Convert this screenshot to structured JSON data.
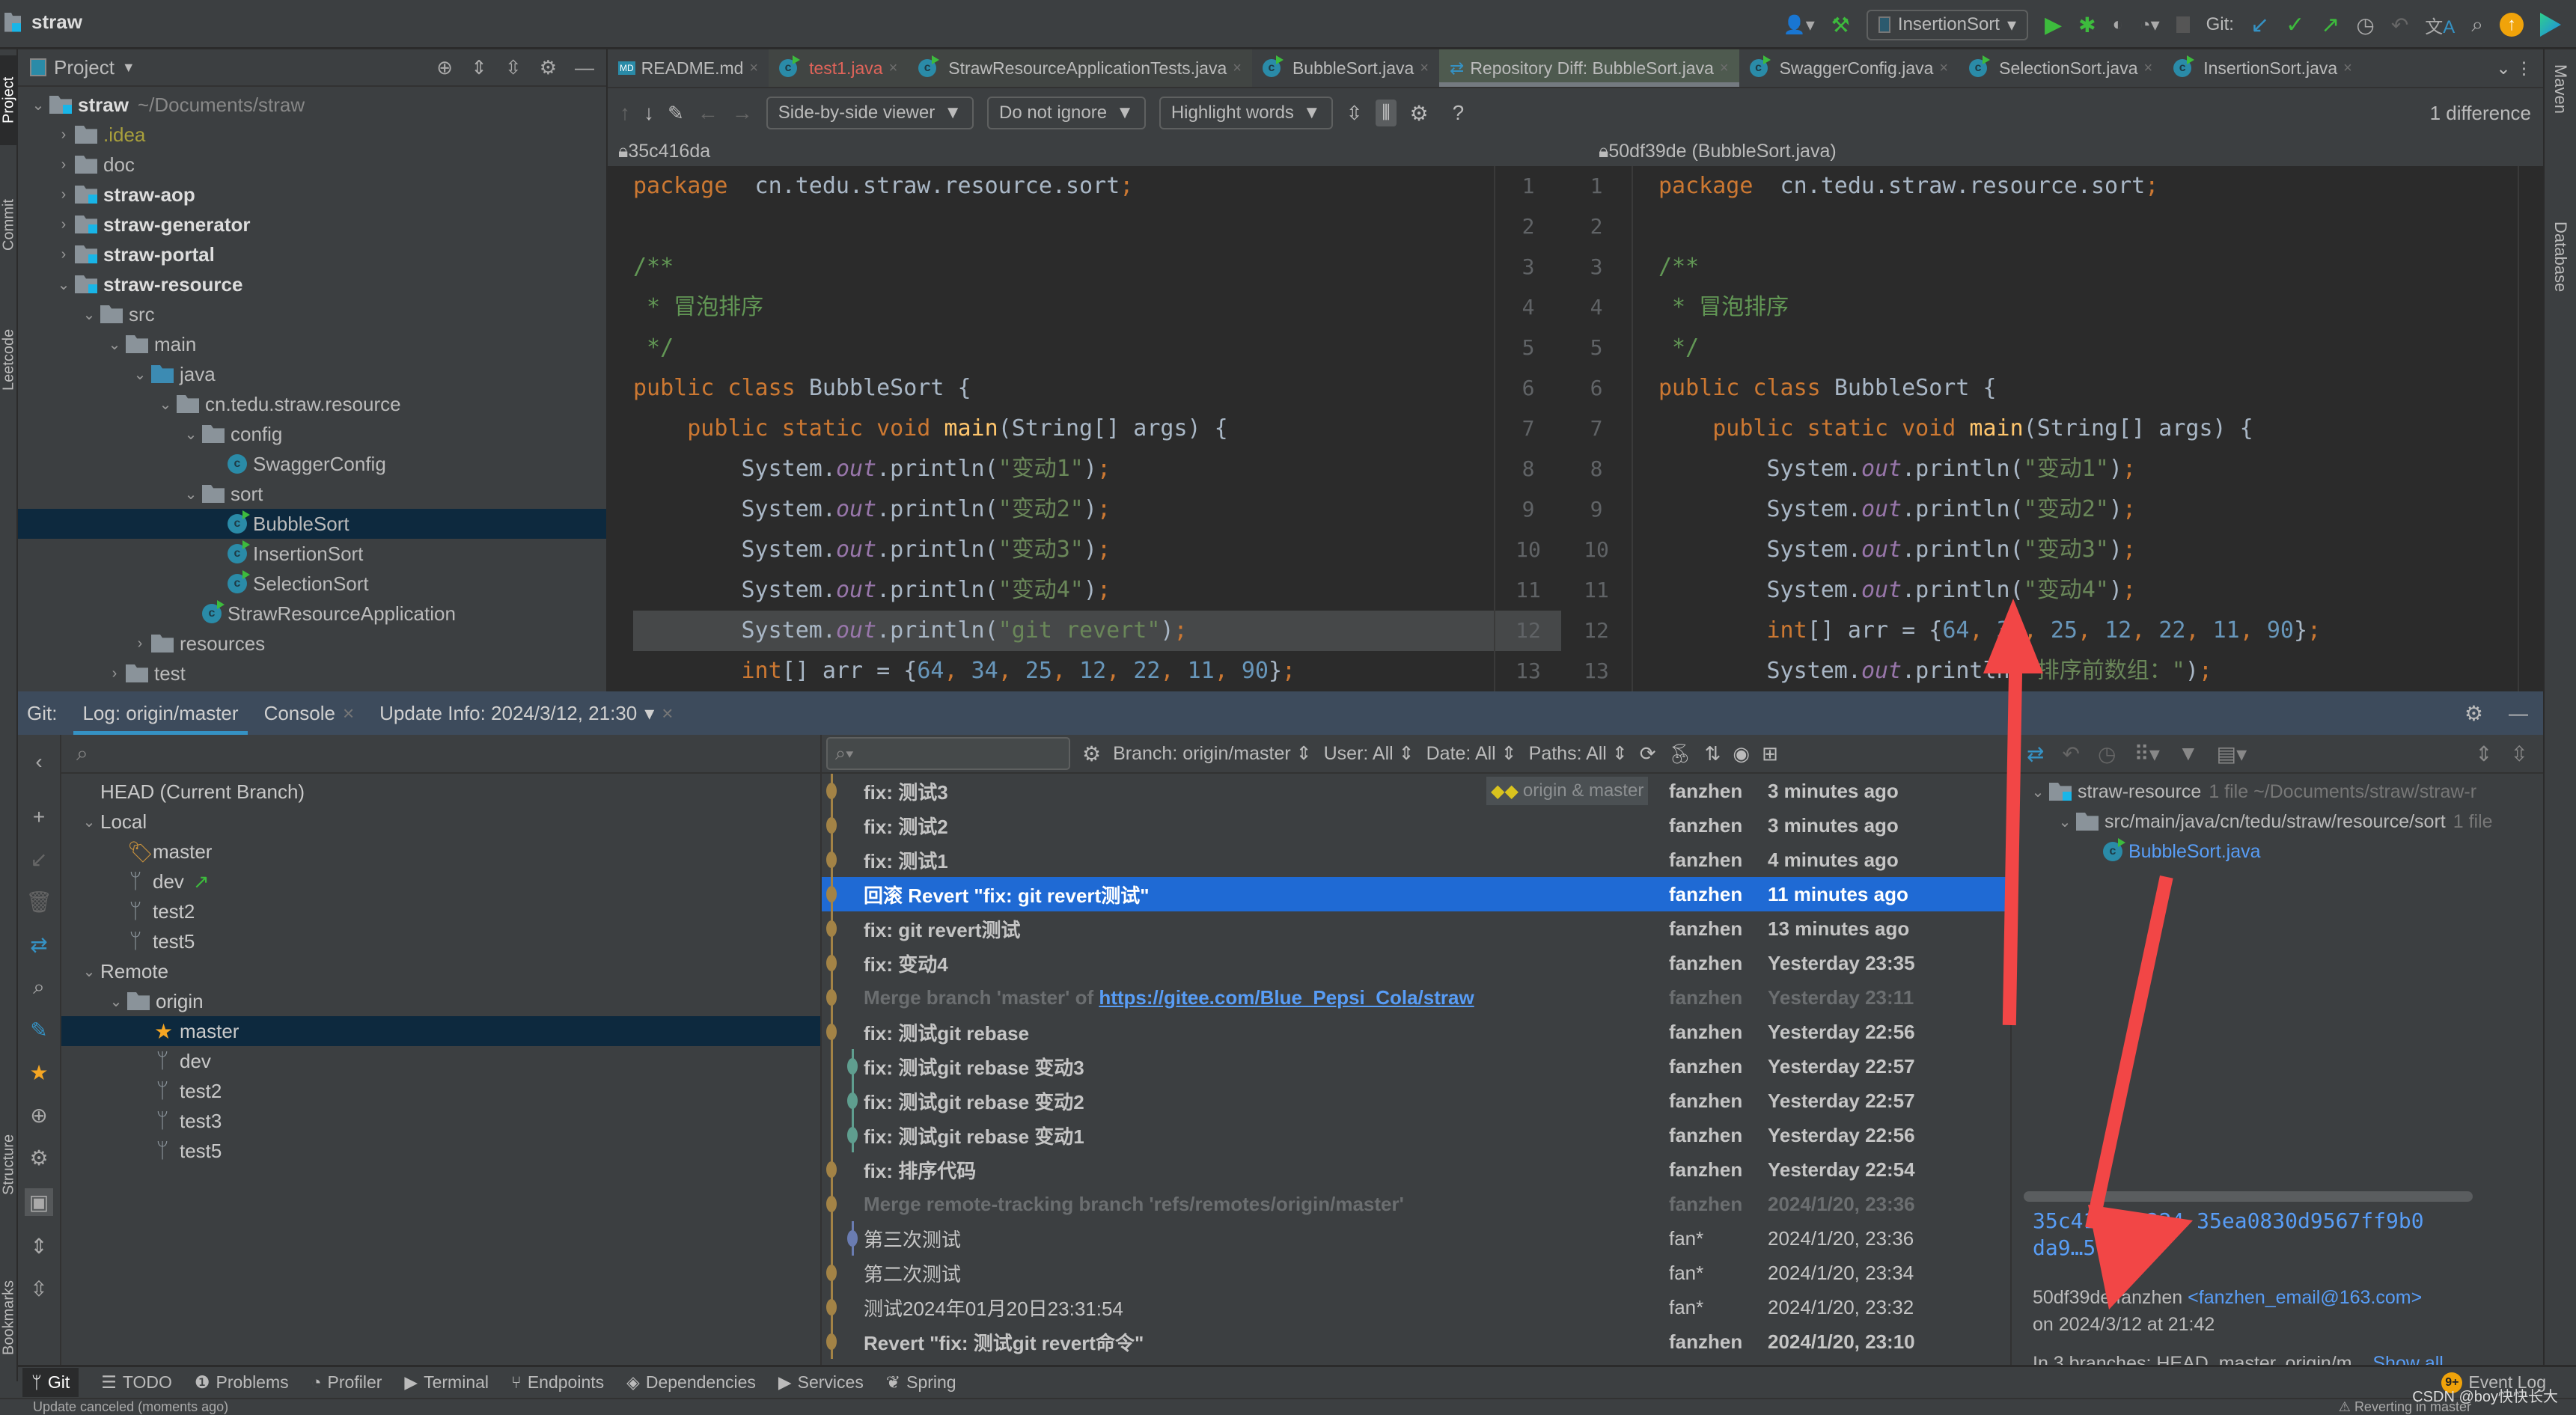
{
  "window": {
    "project_name": "straw"
  },
  "toolbar_top": {
    "run_config": "InsertionSort",
    "git_label": "Git:",
    "icons": [
      "user-icon",
      "build-hammer-icon",
      "run-icon",
      "debug-icon",
      "coverage-icon",
      "profile-icon",
      "stop-icon",
      "git-update-icon",
      "git-commit-icon",
      "git-push-icon",
      "history-icon",
      "rollback-icon",
      "translate-icon",
      "search-icon",
      "update-icon",
      "toolbox-icon"
    ]
  },
  "side_tabs_left": [
    "Project",
    "Commit",
    "Leetcode",
    "Structure",
    "Bookmarks"
  ],
  "side_tabs_right": [
    "Maven",
    "Database"
  ],
  "project_panel": {
    "title": "Project",
    "tree": [
      {
        "label": "straw",
        "hint": "~/Documents/straw",
        "depth": 0,
        "expanded": true,
        "type": "module",
        "bold": true
      },
      {
        "label": ".idea",
        "depth": 1,
        "expanded": false,
        "type": "folder",
        "color": "#a9a03c"
      },
      {
        "label": "doc",
        "depth": 1,
        "expanded": false,
        "type": "folder"
      },
      {
        "label": "straw-aop",
        "depth": 1,
        "expanded": false,
        "type": "module",
        "bold": true
      },
      {
        "label": "straw-generator",
        "depth": 1,
        "expanded": false,
        "type": "module",
        "bold": true
      },
      {
        "label": "straw-portal",
        "depth": 1,
        "expanded": false,
        "type": "module",
        "bold": true
      },
      {
        "label": "straw-resource",
        "depth": 1,
        "expanded": true,
        "type": "module",
        "bold": true
      },
      {
        "label": "src",
        "depth": 2,
        "expanded": true,
        "type": "folder"
      },
      {
        "label": "main",
        "depth": 3,
        "expanded": true,
        "type": "folder"
      },
      {
        "label": "java",
        "depth": 4,
        "expanded": true,
        "type": "src"
      },
      {
        "label": "cn.tedu.straw.resource",
        "depth": 5,
        "expanded": true,
        "type": "package"
      },
      {
        "label": "config",
        "depth": 6,
        "expanded": true,
        "type": "package"
      },
      {
        "label": "SwaggerConfig",
        "depth": 7,
        "type": "class"
      },
      {
        "label": "sort",
        "depth": 6,
        "expanded": true,
        "type": "package"
      },
      {
        "label": "BubbleSort",
        "depth": 7,
        "type": "class-run",
        "selected": true
      },
      {
        "label": "InsertionSort",
        "depth": 7,
        "type": "class-run"
      },
      {
        "label": "SelectionSort",
        "depth": 7,
        "type": "class-run"
      },
      {
        "label": "StrawResourceApplication",
        "depth": 6,
        "type": "class-run"
      },
      {
        "label": "resources",
        "depth": 4,
        "expanded": false,
        "type": "folder"
      },
      {
        "label": "test",
        "depth": 3,
        "expanded": false,
        "type": "folder"
      }
    ]
  },
  "editor_tabs": [
    {
      "label": "README.md",
      "icon": "markdown-file-icon"
    },
    {
      "label": "test1.java",
      "icon": "java-class-icon",
      "color": "#e0645a",
      "modified": true
    },
    {
      "label": "StrawResourceApplicationTests.java",
      "icon": "java-class-icon",
      "modified": true
    },
    {
      "label": "BubbleSort.java",
      "icon": "java-class-icon"
    },
    {
      "label": "Repository Diff: BubbleSort.java",
      "icon": "diff-icon",
      "active": true
    },
    {
      "label": "SwaggerConfig.java",
      "icon": "java-class-icon"
    },
    {
      "label": "SelectionSort.java",
      "icon": "java-class-icon"
    },
    {
      "label": "InsertionSort.java",
      "icon": "java-class-icon"
    }
  ],
  "diff_toolbar": {
    "viewer": "Side-by-side viewer",
    "ignore": "Do not ignore",
    "highlight": "Highlight words",
    "difference_count": "1 difference",
    "help": "?"
  },
  "diff": {
    "left_rev": "35c416da",
    "right_rev": "50df39de (BubbleSort.java)",
    "left_lines": [
      {
        "n": "1",
        "tokens": [
          [
            "kw",
            "package"
          ],
          [
            "",
            "  cn.tedu.straw.resource.sort"
          ],
          [
            "kw",
            ";"
          ]
        ]
      },
      {
        "n": "2",
        "tokens": []
      },
      {
        "n": "3",
        "tokens": [
          [
            "cmt",
            "/**"
          ]
        ]
      },
      {
        "n": "4",
        "tokens": [
          [
            "cmt",
            " * 冒泡排序"
          ]
        ]
      },
      {
        "n": "5",
        "tokens": [
          [
            "cmt",
            " */"
          ]
        ]
      },
      {
        "n": "6",
        "tokens": [
          [
            "kw",
            "public class "
          ],
          [
            "",
            "BubbleSort {"
          ]
        ]
      },
      {
        "n": "7",
        "tokens": [
          [
            "kw",
            "    public static void "
          ],
          [
            "fn",
            "main"
          ],
          [
            "",
            "(String[] args) {"
          ]
        ]
      },
      {
        "n": "8",
        "tokens": [
          [
            "",
            "        System."
          ],
          [
            "fld",
            "out"
          ],
          [
            "",
            ".println("
          ],
          [
            "str",
            "\"变动1\""
          ],
          [
            "",
            ")"
          ],
          [
            "kw",
            ";"
          ]
        ]
      },
      {
        "n": "9",
        "tokens": [
          [
            "",
            "        System."
          ],
          [
            "fld",
            "out"
          ],
          [
            "",
            ".println("
          ],
          [
            "str",
            "\"变动2\""
          ],
          [
            "",
            ")"
          ],
          [
            "kw",
            ";"
          ]
        ]
      },
      {
        "n": "10",
        "tokens": [
          [
            "",
            "        System."
          ],
          [
            "fld",
            "out"
          ],
          [
            "",
            ".println("
          ],
          [
            "str",
            "\"变动3\""
          ],
          [
            "",
            ")"
          ],
          [
            "kw",
            ";"
          ]
        ]
      },
      {
        "n": "11",
        "tokens": [
          [
            "",
            "        System."
          ],
          [
            "fld",
            "out"
          ],
          [
            "",
            ".println("
          ],
          [
            "str",
            "\"变动4\""
          ],
          [
            "",
            ")"
          ],
          [
            "kw",
            ";"
          ]
        ]
      },
      {
        "n": "12",
        "tokens": [
          [
            "",
            "        System."
          ],
          [
            "fld",
            "out"
          ],
          [
            "",
            ".println("
          ],
          [
            "str",
            "\"git revert\""
          ],
          [
            "",
            ")"
          ],
          [
            "kw",
            ";"
          ]
        ],
        "changed": true
      },
      {
        "n": "13",
        "tokens": [
          [
            "kw",
            "        int"
          ],
          [
            "",
            "[] arr = {"
          ],
          [
            "num",
            "64"
          ],
          [
            "kw",
            ", "
          ],
          [
            "num",
            "34"
          ],
          [
            "kw",
            ", "
          ],
          [
            "num",
            "25"
          ],
          [
            "kw",
            ", "
          ],
          [
            "num",
            "12"
          ],
          [
            "kw",
            ", "
          ],
          [
            "num",
            "22"
          ],
          [
            "kw",
            ", "
          ],
          [
            "num",
            "11"
          ],
          [
            "kw",
            ", "
          ],
          [
            "num",
            "90"
          ],
          [
            "",
            "}"
          ],
          [
            "kw",
            ";"
          ]
        ]
      }
    ],
    "right_lines": [
      {
        "n": "1",
        "tokens": [
          [
            "kw",
            "package"
          ],
          [
            "",
            "  cn.tedu.straw.resource.sort"
          ],
          [
            "kw",
            ";"
          ]
        ]
      },
      {
        "n": "2",
        "tokens": []
      },
      {
        "n": "3",
        "tokens": [
          [
            "cmt",
            "/**"
          ]
        ]
      },
      {
        "n": "4",
        "tokens": [
          [
            "cmt",
            " * 冒泡排序"
          ]
        ]
      },
      {
        "n": "5",
        "tokens": [
          [
            "cmt",
            " */"
          ]
        ]
      },
      {
        "n": "6",
        "tokens": [
          [
            "kw",
            "public class "
          ],
          [
            "",
            "BubbleSort {"
          ]
        ]
      },
      {
        "n": "7",
        "tokens": [
          [
            "kw",
            "    public static void "
          ],
          [
            "fn",
            "main"
          ],
          [
            "",
            "(String[] args) {"
          ]
        ]
      },
      {
        "n": "8",
        "tokens": [
          [
            "",
            "        System."
          ],
          [
            "fld",
            "out"
          ],
          [
            "",
            ".println("
          ],
          [
            "str",
            "\"变动1\""
          ],
          [
            "",
            ")"
          ],
          [
            "kw",
            ";"
          ]
        ]
      },
      {
        "n": "9",
        "tokens": [
          [
            "",
            "        System."
          ],
          [
            "fld",
            "out"
          ],
          [
            "",
            ".println("
          ],
          [
            "str",
            "\"变动2\""
          ],
          [
            "",
            ")"
          ],
          [
            "kw",
            ";"
          ]
        ]
      },
      {
        "n": "10",
        "tokens": [
          [
            "",
            "        System."
          ],
          [
            "fld",
            "out"
          ],
          [
            "",
            ".println("
          ],
          [
            "str",
            "\"变动3\""
          ],
          [
            "",
            ")"
          ],
          [
            "kw",
            ";"
          ]
        ]
      },
      {
        "n": "11",
        "tokens": [
          [
            "",
            "        System."
          ],
          [
            "fld",
            "out"
          ],
          [
            "",
            ".println("
          ],
          [
            "str",
            "\"变动4\""
          ],
          [
            "",
            ")"
          ],
          [
            "kw",
            ";"
          ]
        ]
      },
      {
        "n": "12",
        "tokens": [
          [
            "kw",
            "        int"
          ],
          [
            "",
            "[] arr = {"
          ],
          [
            "num",
            "64"
          ],
          [
            "kw",
            ", "
          ],
          [
            "num",
            "34"
          ],
          [
            "kw",
            ", "
          ],
          [
            "num",
            "25"
          ],
          [
            "kw",
            ", "
          ],
          [
            "num",
            "12"
          ],
          [
            "kw",
            ", "
          ],
          [
            "num",
            "22"
          ],
          [
            "kw",
            ", "
          ],
          [
            "num",
            "11"
          ],
          [
            "kw",
            ", "
          ],
          [
            "num",
            "90"
          ],
          [
            "",
            "}"
          ],
          [
            "kw",
            ";"
          ]
        ]
      },
      {
        "n": "13",
        "tokens": [
          [
            "",
            "        System."
          ],
          [
            "fld",
            "out"
          ],
          [
            "",
            ".println("
          ],
          [
            "str",
            "\"排序前数组：\""
          ],
          [
            "",
            ")"
          ],
          [
            "kw",
            ";"
          ]
        ]
      }
    ]
  },
  "git_panel": {
    "label": "Git:",
    "tabs": [
      {
        "label": "Log: origin/master",
        "active": true
      },
      {
        "label": "Console",
        "closable": true
      },
      {
        "label": "Update Info: 2024/3/12, 21:30",
        "closable": true,
        "dropdown": true
      }
    ],
    "branches": [
      {
        "label": "HEAD (Current Branch)",
        "depth": 0,
        "icon": ""
      },
      {
        "label": "Local",
        "depth": 0,
        "expander": "v"
      },
      {
        "label": "master",
        "depth": 1,
        "icon": "tag"
      },
      {
        "label": "dev",
        "depth": 1,
        "icon": "branch",
        "outgoing": true
      },
      {
        "label": "test2",
        "depth": 1,
        "icon": "branch"
      },
      {
        "label": "test5",
        "depth": 1,
        "icon": "branch"
      },
      {
        "label": "Remote",
        "depth": 0,
        "expander": "v"
      },
      {
        "label": "origin",
        "depth": 1,
        "icon": "folder",
        "expander": "v"
      },
      {
        "label": "master",
        "depth": 2,
        "icon": "star",
        "selected": true
      },
      {
        "label": "dev",
        "depth": 2,
        "icon": "branch"
      },
      {
        "label": "test2",
        "depth": 2,
        "icon": "branch"
      },
      {
        "label": "test3",
        "depth": 2,
        "icon": "branch"
      },
      {
        "label": "test5",
        "depth": 2,
        "icon": "branch"
      }
    ],
    "log_filters": {
      "search_placeholder": "",
      "branch": "Branch: origin/master",
      "user": "User: All",
      "date": "Date: All",
      "paths": "Paths: All"
    },
    "commits": [
      {
        "msg": "fix: 测试3",
        "author": "fanzhen",
        "date": "3 minutes ago",
        "refs": "origin & master",
        "lane": 0
      },
      {
        "msg": "fix: 测试2",
        "author": "fanzhen",
        "date": "3 minutes ago",
        "lane": 0
      },
      {
        "msg": "fix: 测试1",
        "author": "fanzhen",
        "date": "4 minutes ago",
        "lane": 0
      },
      {
        "msg": "回滚 Revert \"fix: git revert测试\"",
        "author": "fanzhen",
        "date": "11 minutes ago",
        "lane": 0,
        "selected": true
      },
      {
        "msg": "fix: git revert测试",
        "author": "fanzhen",
        "date": "13 minutes ago",
        "lane": 0
      },
      {
        "msg": "fix: 变动4",
        "author": "fanzhen",
        "date": "Yesterday 23:35",
        "lane": 0
      },
      {
        "msg": "Merge branch 'master' of ",
        "link": "https://gitee.com/Blue_Pepsi_Cola/straw",
        "author": "fanzhen",
        "date": "Yesterday 23:11",
        "lane": 0,
        "dim": true
      },
      {
        "msg": "fix: 测试git rebase",
        "author": "fanzhen",
        "date": "Yesterday 22:56",
        "lane": 0
      },
      {
        "msg": "fix: 测试git rebase 变动3",
        "author": "fanzhen",
        "date": "Yesterday 22:57",
        "lane": 1
      },
      {
        "msg": "fix: 测试git rebase 变动2",
        "author": "fanzhen",
        "date": "Yesterday 22:57",
        "lane": 1
      },
      {
        "msg": "fix: 测试git rebase 变动1",
        "author": "fanzhen",
        "date": "Yesterday 22:56",
        "lane": 1
      },
      {
        "msg": "fix: 排序代码",
        "author": "fanzhen",
        "date": "Yesterday 22:54",
        "lane": 0
      },
      {
        "msg": "Merge remote-tracking branch 'refs/remotes/origin/master'",
        "author": "fanzhen",
        "date": "2024/1/20, 23:36",
        "lane": 0,
        "dim": true
      },
      {
        "msg": "第三次测试",
        "author": "fan*",
        "date": "2024/1/20, 23:36",
        "lane": 1,
        "normal": true
      },
      {
        "msg": "第二次测试",
        "author": "fan*",
        "date": "2024/1/20, 23:34",
        "lane": 0,
        "normal": true
      },
      {
        "msg": "测试2024年01月20日23:31:54",
        "author": "fan*",
        "date": "2024/1/20, 23:32",
        "lane": 0,
        "normal": true
      },
      {
        "msg": "Revert \"fix: 测试git revert命令\"",
        "author": "fanzhen",
        "date": "2024/1/20, 23:10",
        "lane": 0
      }
    ],
    "changes_tree": [
      {
        "label": "straw-resource",
        "meta": "1 file  ~/Documents/straw/straw-r",
        "depth": 0
      },
      {
        "label": "src/main/java/cn/tedu/straw/resource/sort",
        "meta": "1 file",
        "depth": 1
      },
      {
        "label": "BubbleSort.java",
        "depth": 2,
        "file": true
      }
    ],
    "commit_details": {
      "hash_partial_1": "35c41…ae3224 35ea0830d9567ff9b0",
      "hash_partial_2": "da9…5f.",
      "short_hash": "50df39de",
      "author": "fanzhen",
      "email": "<fanzhen_email@163.com>",
      "date_line": "on 2024/3/12 at 21:42",
      "branches_line": "In 3 branches: HEAD, master, origin/m...",
      "show_all": "Show all"
    }
  },
  "bottom_tools": [
    {
      "label": "Git",
      "icon": "git-branch-icon",
      "active": true
    },
    {
      "label": "TODO",
      "icon": "list-icon"
    },
    {
      "label": "Problems",
      "icon": "problems-icon"
    },
    {
      "label": "Profiler",
      "icon": "profiler-icon"
    },
    {
      "label": "Terminal",
      "icon": "terminal-icon"
    },
    {
      "label": "Endpoints",
      "icon": "endpoints-icon"
    },
    {
      "label": "Dependencies",
      "icon": "dependencies-icon"
    },
    {
      "label": "Services",
      "icon": "services-icon"
    },
    {
      "label": "Spring",
      "icon": "spring-icon"
    }
  ],
  "event_log": {
    "label": "Event Log",
    "badge": "9+"
  },
  "watermark": "CSDN @boy快快长大",
  "status": {
    "left": "Update canceled (moments ago)",
    "right": "Reverting in master"
  }
}
